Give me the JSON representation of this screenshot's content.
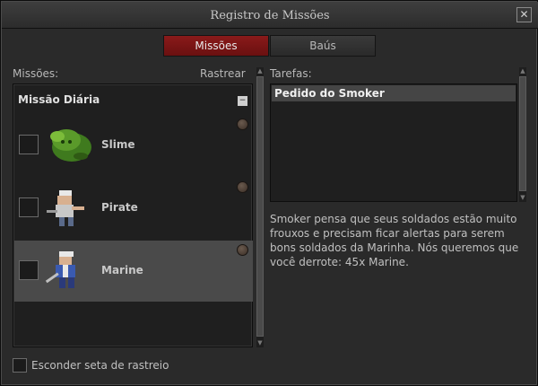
{
  "window": {
    "title": "Registro de Missões"
  },
  "tabs": [
    {
      "label": "Missões",
      "active": true
    },
    {
      "label": "Baús",
      "active": false
    }
  ],
  "missions_panel": {
    "label": "Missões:",
    "track_label": "Rastrear",
    "group": {
      "title": "Missão Diária",
      "collapse_symbol": "−",
      "items": [
        {
          "name": "Slime",
          "selected": false,
          "sprite_icon": "slime-icon"
        },
        {
          "name": "Pirate",
          "selected": false,
          "sprite_icon": "pirate-icon"
        },
        {
          "name": "Marine",
          "selected": true,
          "sprite_icon": "marine-icon"
        }
      ]
    }
  },
  "tasks_panel": {
    "label": "Tarefas:",
    "items": [
      {
        "label": "Pedido do Smoker",
        "selected": true
      }
    ]
  },
  "description": "Smoker pensa que seus soldados estão muito frouxos e precisam ficar alertas para serem bons soldados da Marinha. Nós queremos que você derrote: 45x Marine.",
  "footer": {
    "hide_arrow_label": "Esconder seta de rastreio",
    "hide_arrow_checked": false
  },
  "colors": {
    "active_tab": "#7a1414",
    "selected_row": "#4a4a4a",
    "panel_bg": "#1f1f1f"
  }
}
